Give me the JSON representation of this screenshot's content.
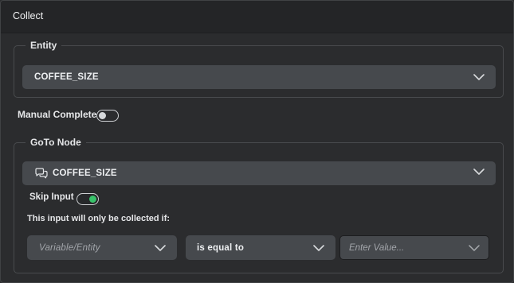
{
  "header": {
    "title": "Collect"
  },
  "entity": {
    "legend": "Entity",
    "selected": "COFFEE_SIZE",
    "dropdown_icon": "chevron-down-icon"
  },
  "manual_complete": {
    "label": "Manual Complete",
    "enabled": false
  },
  "goto_node": {
    "legend": "GoTo Node",
    "node_icon": "chat-bubbles-icon",
    "selected": "COFFEE_SIZE",
    "skip_input": {
      "label": "Skip Input",
      "enabled": true,
      "on_color": "#38c26a"
    },
    "condition_note": "This input will only be collected if:",
    "condition": {
      "variable_placeholder": "Variable/Entity",
      "operator": "is equal to",
      "value_placeholder": "Enter Value..."
    }
  }
}
